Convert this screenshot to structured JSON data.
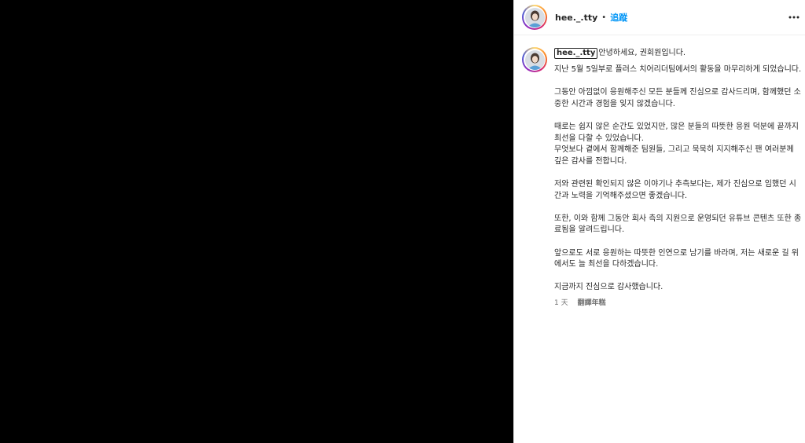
{
  "media": {
    "color": "#000000"
  },
  "header": {
    "username": "hee._.tty",
    "separator": "•",
    "follow_label": "追蹤",
    "more_icon": "more-horizontal-icon"
  },
  "caption": {
    "username": "hee._.tty",
    "first_line": "안녕하세요, 권회원입니다.",
    "body": "지난 5월 5일부로 플러스 치어리더팀에서의 활동을 마무리하게 되었습니다.\n\n그동안 아낌없이 응원해주신 모든 분들께 진심으로 감사드리며, 함께했던 소중한 시간과 경험을 잊지 않겠습니다.\n\n때로는 쉽지 않은 순간도 있었지만, 많은 분들의 따뜻한 응원 덕분에 끝까지 최선을 다할 수 있었습니다.\n무엇보다 곁에서 함께해준 팀원들, 그리고 묵묵히 지지해주신 팬 여러분께 깊은 감사를 전합니다.\n\n저와 관련된 확인되지 않은 이야기나 추측보다는, 제가 진심으로 임했던 시간과 노력을 기억해주셨으면 좋겠습니다.\n\n또한, 이와 함께 그동안 회사 측의 지원으로 운영되던 유튜브 콘텐츠 또한 종료됨을 알려드립니다.\n\n앞으로도 서로 응원하는 따뜻한 인연으로 남기를 바라며, 저는 새로운 길 위에서도 늘 최선을 다하겠습니다.\n\n지금까지 진심으로 감사했습니다.",
    "time": "1 天",
    "translate_label": "翻譯年糕"
  },
  "colors": {
    "accent": "#0095f6",
    "text": "#262626",
    "muted": "#737373",
    "border": "#dbdbdb"
  }
}
